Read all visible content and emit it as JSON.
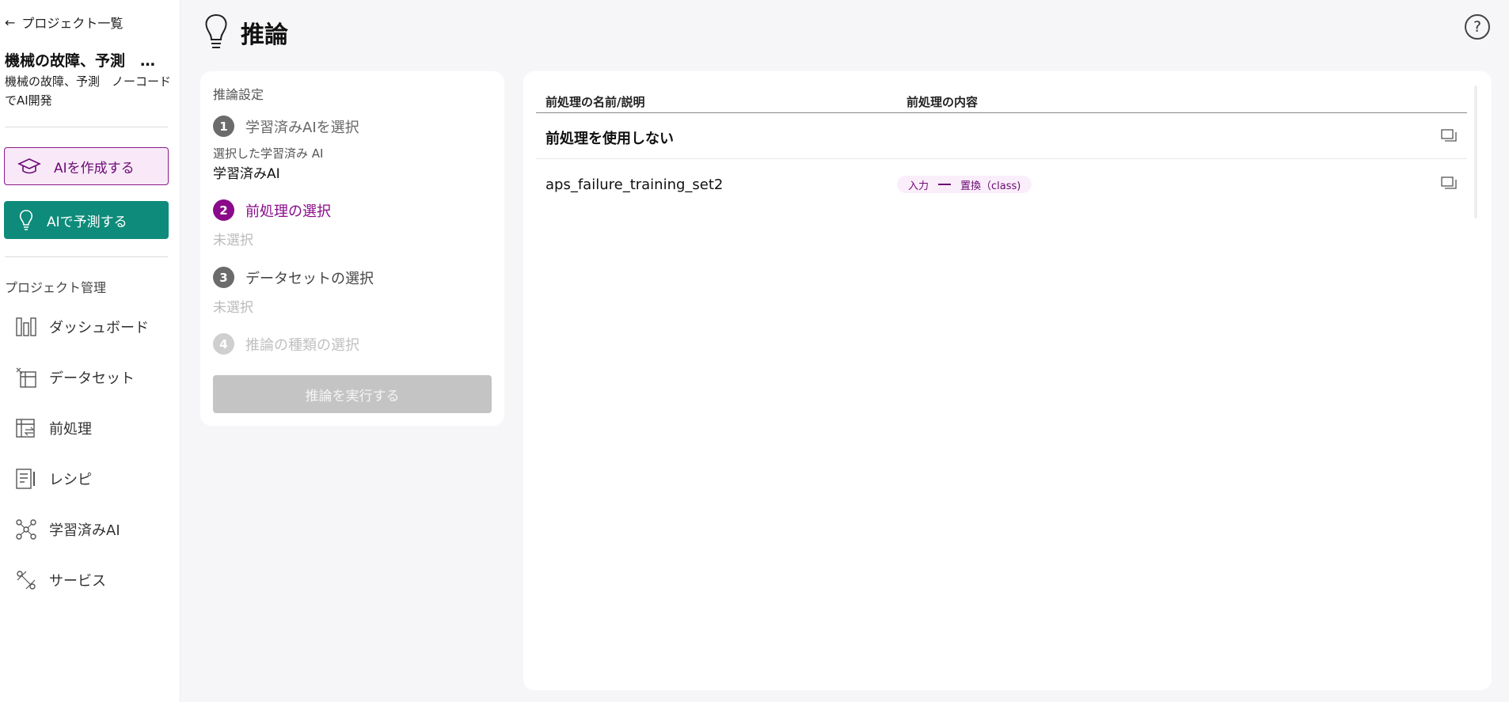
{
  "sidebar": {
    "back_label": "プロジェクト一覧",
    "project_title": "機械の故障、予測　…",
    "project_desc": "機械の故障、予測　ノーコードでAI開発",
    "create_ai_label": "AIを作成する",
    "predict_ai_label": "AIで予測する",
    "section_label": "プロジェクト管理",
    "nav": [
      {
        "label": "ダッシュボード",
        "icon": "dashboard-icon"
      },
      {
        "label": "データセット",
        "icon": "dataset-icon"
      },
      {
        "label": "前処理",
        "icon": "preprocess-icon"
      },
      {
        "label": "レシピ",
        "icon": "recipe-icon"
      },
      {
        "label": "学習済みAI",
        "icon": "trained-ai-icon"
      },
      {
        "label": "サービス",
        "icon": "service-icon"
      }
    ]
  },
  "header": {
    "title": "推論",
    "icon": "lightbulb-icon",
    "help": "?"
  },
  "settings": {
    "heading": "推論設定",
    "steps": [
      {
        "num": "1",
        "label": "学習済みAIを選択",
        "state": "done"
      },
      {
        "num": "2",
        "label": "前処理の選択",
        "state": "active"
      },
      {
        "num": "3",
        "label": "データセットの選択",
        "state": "pending"
      },
      {
        "num": "4",
        "label": "推論の種類の選択",
        "state": "disabled"
      }
    ],
    "step1_sublabel": "選択した学習済み AI",
    "step1_value": "学習済みAI",
    "step2_placeholder": "未選択",
    "step3_placeholder": "未選択",
    "run_label": "推論を実行する"
  },
  "table": {
    "col_name": "前処理の名前/説明",
    "col_content": "前処理の内容",
    "rows": [
      {
        "name": "前処理を使用しない",
        "chip": null
      },
      {
        "name": "aps_failure_training_set2",
        "chip": {
          "from": "入力",
          "to": "置換（class)"
        }
      }
    ]
  },
  "colors": {
    "accent_purple": "#8a1a8a",
    "accent_teal": "#0e8b7a",
    "step_active": "#8a0a8a",
    "step_done": "#6b6b6b"
  }
}
